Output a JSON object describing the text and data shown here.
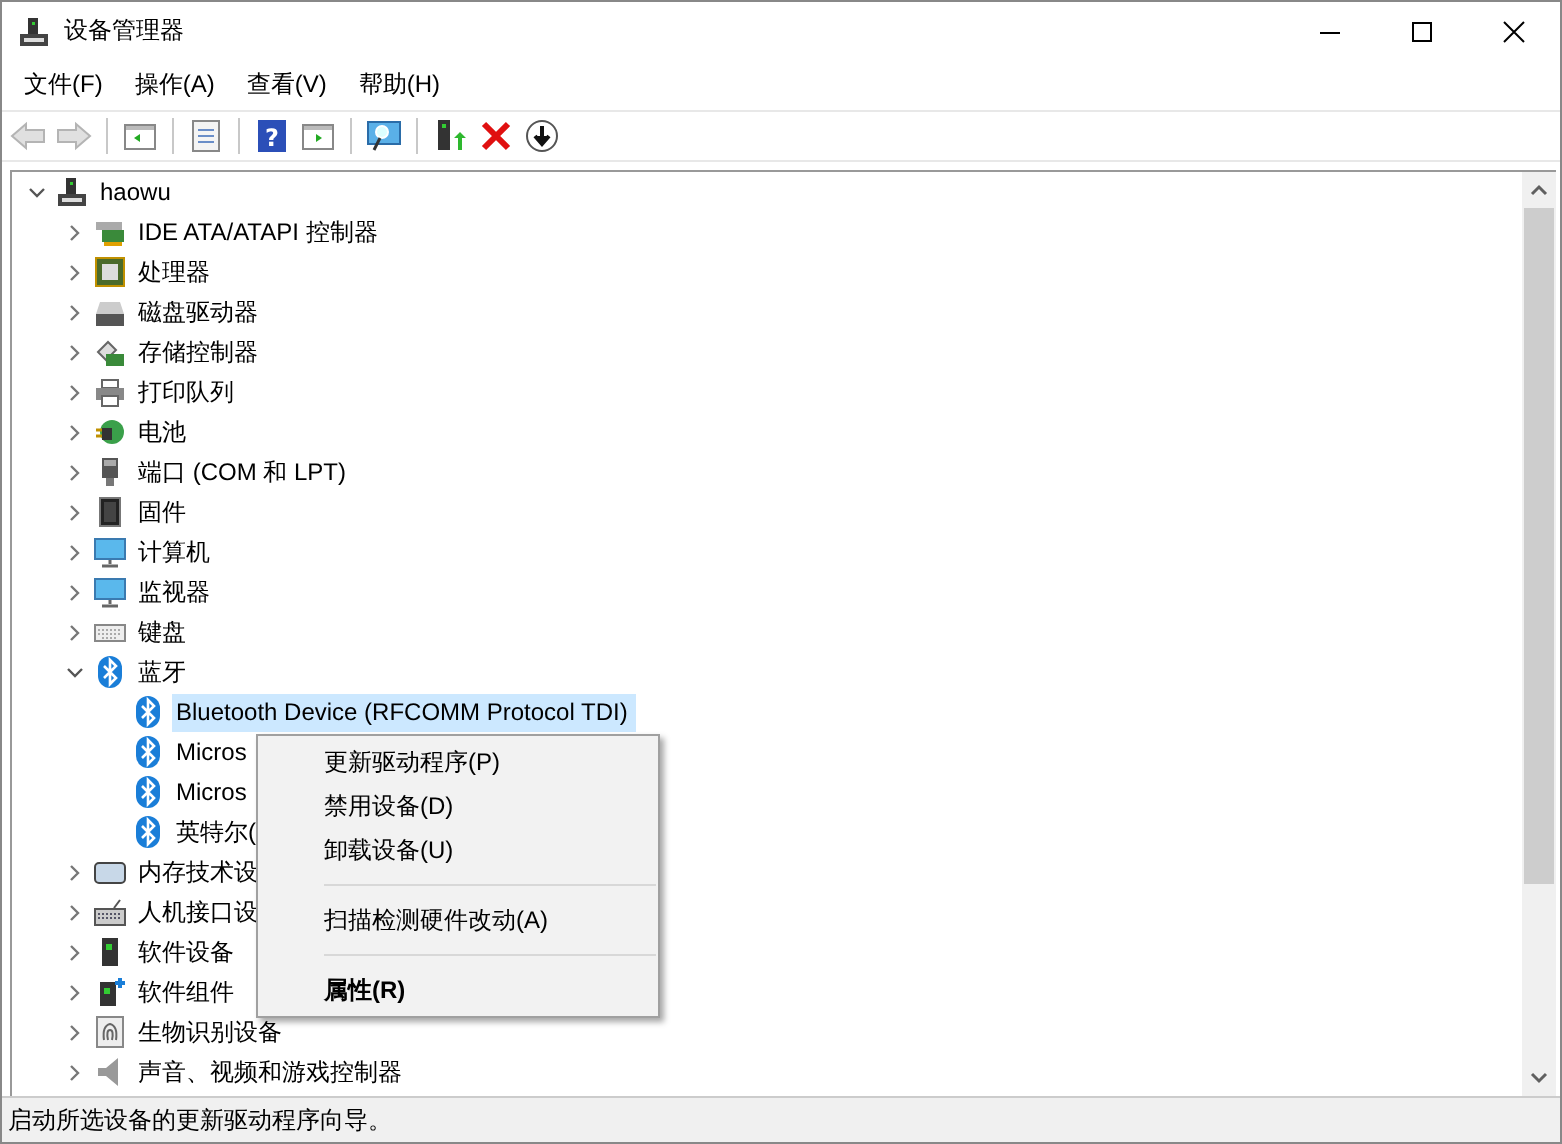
{
  "window": {
    "title": "设备管理器"
  },
  "menu_bar": [
    {
      "label": "文件(F)"
    },
    {
      "label": "操作(A)"
    },
    {
      "label": "查看(V)"
    },
    {
      "label": "帮助(H)"
    }
  ],
  "toolbar": [
    {
      "kind": "back",
      "disabled": true
    },
    {
      "kind": "forward",
      "disabled": true
    },
    {
      "kind": "separator"
    },
    {
      "kind": "console-tree",
      "disabled": false
    },
    {
      "kind": "separator"
    },
    {
      "kind": "properties",
      "disabled": false
    },
    {
      "kind": "separator"
    },
    {
      "kind": "help",
      "disabled": false,
      "label": "?"
    },
    {
      "kind": "action-pane",
      "disabled": false
    },
    {
      "kind": "separator"
    },
    {
      "kind": "scan",
      "disabled": false
    },
    {
      "kind": "separator"
    },
    {
      "kind": "update",
      "disabled": false
    },
    {
      "kind": "uninstall",
      "disabled": false
    },
    {
      "kind": "disable",
      "disabled": false
    }
  ],
  "tree": [
    {
      "label": "haowu",
      "kind": "computer",
      "expanded": true,
      "selected": false,
      "children": [
        {
          "label": "IDE ATA/ATAPI 控制器",
          "kind": "ide",
          "expanded": false,
          "selected": false
        },
        {
          "label": "处理器",
          "kind": "cpu",
          "expanded": false,
          "selected": false
        },
        {
          "label": "磁盘驱动器",
          "kind": "disk",
          "expanded": false,
          "selected": false
        },
        {
          "label": "存储控制器",
          "kind": "storage",
          "expanded": false,
          "selected": false
        },
        {
          "label": "打印队列",
          "kind": "printer",
          "expanded": false,
          "selected": false
        },
        {
          "label": "电池",
          "kind": "battery",
          "expanded": false,
          "selected": false
        },
        {
          "label": "端口 (COM 和 LPT)",
          "kind": "port",
          "expanded": false,
          "selected": false
        },
        {
          "label": "固件",
          "kind": "firmware",
          "expanded": false,
          "selected": false
        },
        {
          "label": "计算机",
          "kind": "monitor",
          "expanded": false,
          "selected": false
        },
        {
          "label": "监视器",
          "kind": "monitor",
          "expanded": false,
          "selected": false
        },
        {
          "label": "键盘",
          "kind": "keyboard",
          "expanded": false,
          "selected": false
        },
        {
          "label": "蓝牙",
          "kind": "bluetooth",
          "expanded": true,
          "selected": false,
          "children": [
            {
              "label": "Bluetooth Device (RFCOMM Protocol TDI)",
              "kind": "bluetooth",
              "selected": true
            },
            {
              "label": "Micros",
              "kind": "bluetooth",
              "selected": false
            },
            {
              "label": "Micros",
              "kind": "bluetooth",
              "selected": false
            },
            {
              "label": "英特尔(",
              "kind": "bluetooth",
              "selected": false
            }
          ]
        },
        {
          "label": "内存技术设",
          "kind": "memory",
          "expanded": false,
          "selected": false
        },
        {
          "label": "人机接口设",
          "kind": "hid",
          "expanded": false,
          "selected": false
        },
        {
          "label": "软件设备",
          "kind": "software",
          "expanded": false,
          "selected": false
        },
        {
          "label": "软件组件",
          "kind": "softcomp",
          "expanded": false,
          "selected": false
        },
        {
          "label": "生物识别设备",
          "kind": "biometric",
          "expanded": false,
          "selected": false
        },
        {
          "label": "声音、视频和游戏控制器",
          "kind": "sound",
          "expanded": false,
          "selected": false
        }
      ]
    }
  ],
  "context_menu": [
    {
      "kind": "item",
      "label": "更新驱动程序(P)"
    },
    {
      "kind": "item",
      "label": "禁用设备(D)"
    },
    {
      "kind": "item",
      "label": "卸载设备(U)"
    },
    {
      "kind": "separator"
    },
    {
      "kind": "item",
      "label": "扫描检测硬件改动(A)"
    },
    {
      "kind": "separator"
    },
    {
      "kind": "default",
      "label": "属性(R)"
    }
  ],
  "status_bar": "启动所选设备的更新驱动程序向导。"
}
